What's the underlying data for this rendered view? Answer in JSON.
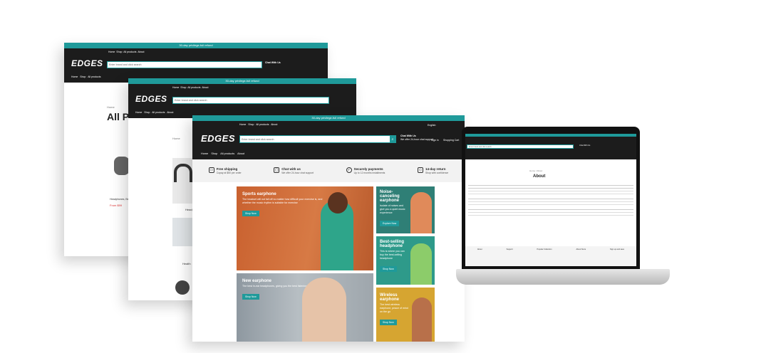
{
  "announcement": "30-day privilege-full refund",
  "logo": "EDGES",
  "utility_links": [
    "Home",
    "Shop",
    "All products",
    "About"
  ],
  "language": "English",
  "search": {
    "placeholder": "Enter brand and click search"
  },
  "chat": {
    "title": "Chat With Us",
    "sub": "We offer 24-hour chat support"
  },
  "account": {
    "sign_in": "Sign in",
    "cart": "Shopping Cart"
  },
  "nav": [
    "Home",
    "Shop",
    "All products",
    "About"
  ],
  "window1": {
    "breadcrumb": "Home",
    "heading": "All Pr",
    "product": "Headphones, Beats",
    "price": "From $99"
  },
  "window2": {
    "breadcrumb": "Home",
    "product_a": "Headp",
    "product_b": "Health"
  },
  "features": [
    {
      "title": "Free shipping",
      "desc": "Copay at $50 per order"
    },
    {
      "title": "Chat with us",
      "desc": "We offer 24-hour chat support"
    },
    {
      "title": "Securely payments",
      "desc": "Up to 12 months installments"
    },
    {
      "title": "14-day return",
      "desc": "Shop with confidence"
    }
  ],
  "tiles": [
    {
      "title": "Sports earphone",
      "desc": "The headset will not fall off no matter how difficult your exercise is, and whether the music rhythm is suitable for exercise",
      "button": "Shop Now"
    },
    {
      "title": "Noise-canceling earphone",
      "desc": "Isolate of noises and give you a quiet music experience",
      "button": "Explore Now"
    },
    {
      "title": "Best-selling headphone",
      "desc": "This is where you can buy the best-selling headphone",
      "button": "Shop Now"
    },
    {
      "title": "New earphone",
      "desc": "The best in-ear headphones, giving you the best listening experience",
      "button": "Shop Now"
    },
    {
      "title": "Wireless earphone",
      "desc": "The best wireless earphone, peace of mind on the go",
      "button": "Shop Now"
    }
  ],
  "laptop": {
    "page_title": "About",
    "breadcrumb": "Home / About",
    "footer_cols": [
      "About",
      "Support",
      "Popular Collection",
      "About Store",
      "Sign up and save"
    ]
  },
  "colors": {
    "accent": "#1f9a9a",
    "header": "#1c1c1c",
    "tile_orange": "#cf6a37",
    "tile_teal": "#2f7f76",
    "tile_mustard": "#d6a531"
  }
}
